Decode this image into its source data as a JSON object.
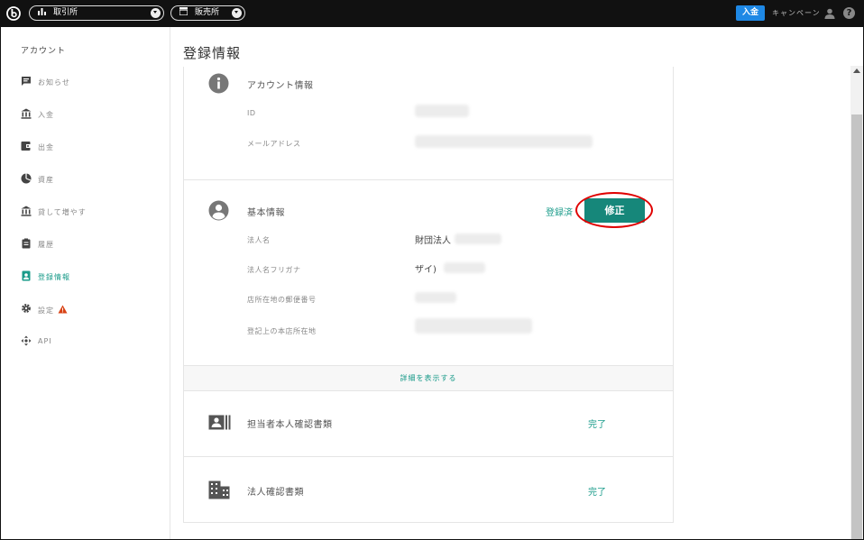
{
  "topbar": {
    "exchange_label": "取引所",
    "shop_label": "販売所",
    "deposit_label": "入金",
    "campaign_label": "キャンペーン"
  },
  "sidebar": {
    "title": "アカウント",
    "items": [
      {
        "label": "お知らせ",
        "icon": "message-icon"
      },
      {
        "label": "入金",
        "icon": "bank-icon"
      },
      {
        "label": "出金",
        "icon": "wallet-icon"
      },
      {
        "label": "資産",
        "icon": "pie-chart-icon"
      },
      {
        "label": "貸して増やす",
        "icon": "bank-icon"
      },
      {
        "label": "履歴",
        "icon": "clipboard-icon"
      },
      {
        "label": "登録情報",
        "icon": "id-badge-icon",
        "active": true
      },
      {
        "label": "設定",
        "icon": "gear-icon",
        "warning": true
      },
      {
        "label": "API",
        "icon": "move-arrows-icon"
      }
    ]
  },
  "page": {
    "title": "登録情報"
  },
  "account_info": {
    "title": "アカウント情報",
    "id_label": "ID",
    "email_label": "メールアドレス"
  },
  "basic_info": {
    "title": "基本情報",
    "registered_link": "登録済",
    "edit_label": "修正",
    "corp_name_label": "法人名",
    "corp_name_value": "財団法人",
    "corp_kana_label": "法人名フリガナ",
    "corp_kana_value": "ザイ)",
    "postal_label": "店所在地の郵便番号",
    "address_label": "登記上の本店所在地"
  },
  "details_link": "詳細を表示する",
  "identity_docs": {
    "title": "担当者本人確認書類",
    "status": "完了"
  },
  "corp_docs": {
    "title": "法人確認書類",
    "status": "完了"
  },
  "colors": {
    "accent": "#1a9b8a",
    "button": "#16877a",
    "deposit": "#1e88e5",
    "highlight_ring": "#e00000"
  }
}
